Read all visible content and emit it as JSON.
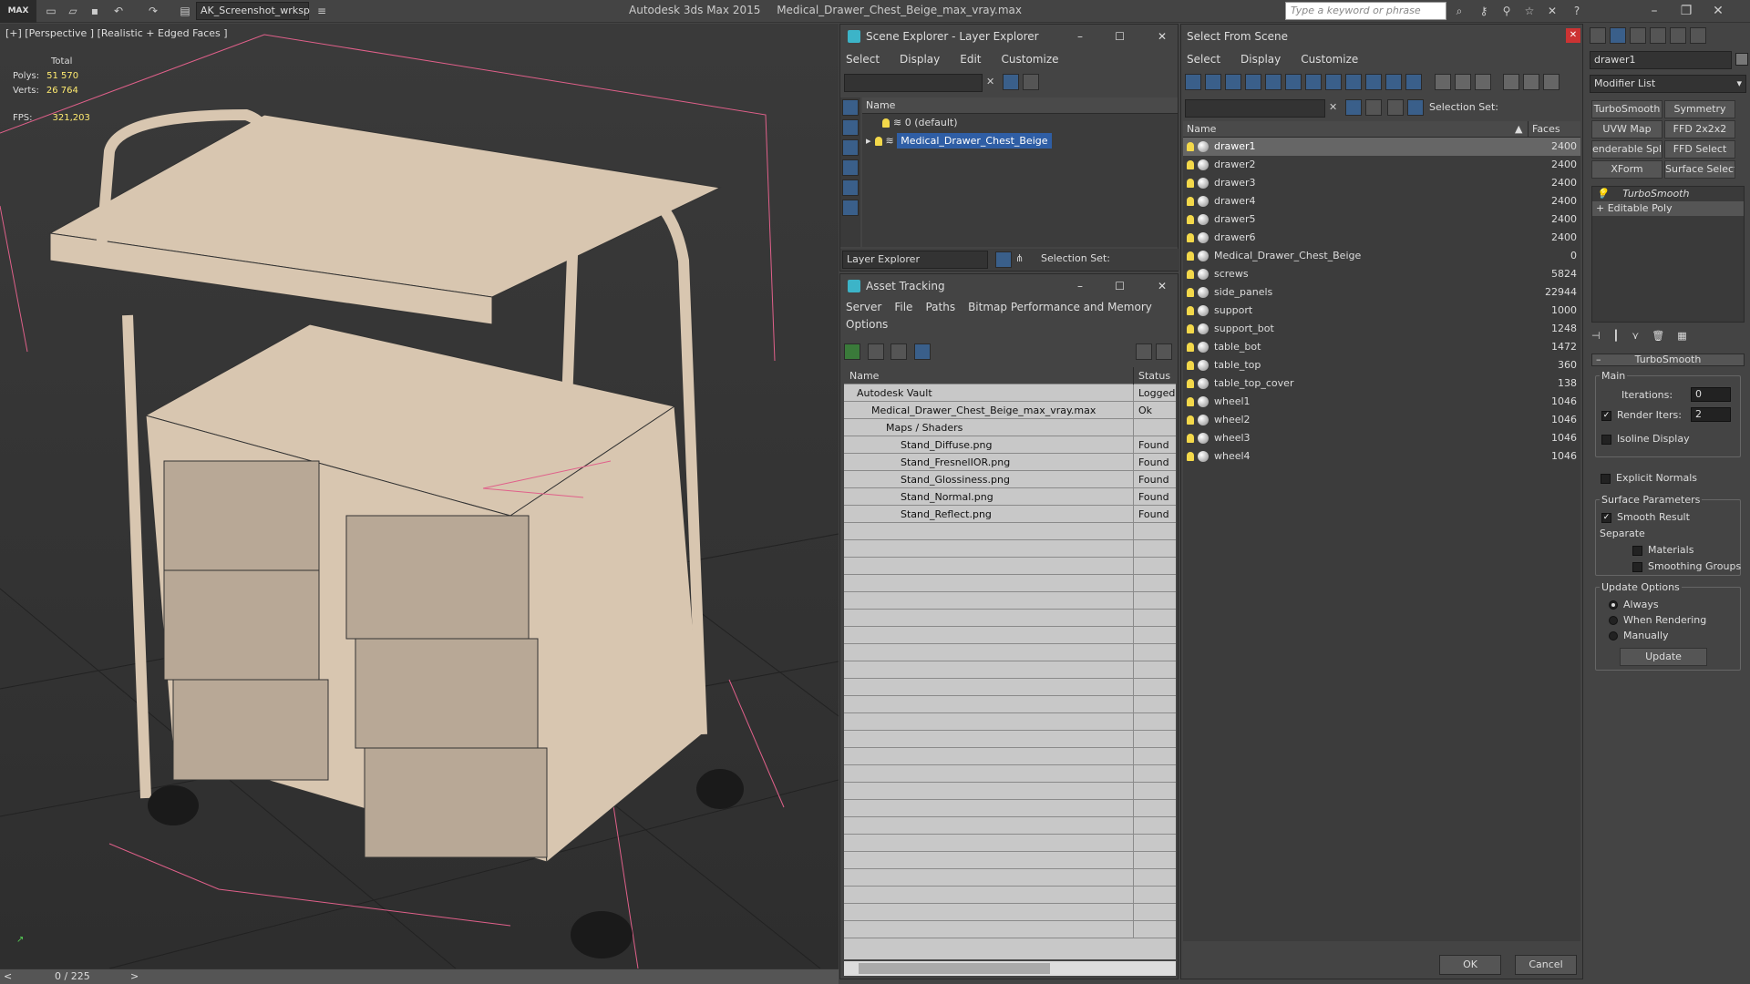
{
  "app": {
    "logo": "MAX",
    "workspace": "AK_Screenshot_wrksp",
    "title_app": "Autodesk 3ds Max  2015",
    "title_file": "Medical_Drawer_Chest_Beige_max_vray.max",
    "search_placeholder": "Type a keyword or phrase"
  },
  "viewport": {
    "label": "[+] [Perspective ] [Realistic + Edged Faces ]",
    "stats_total": "Total",
    "polys_label": "Polys:",
    "polys_value": "51 570",
    "verts_label": "Verts:",
    "verts_value": "26 764",
    "fps_label": "FPS:",
    "fps_value": "321,203",
    "frame": "0 / 225"
  },
  "scene_explorer": {
    "title": "Scene Explorer - Layer Explorer",
    "menu": [
      "Select",
      "Display",
      "Edit",
      "Customize"
    ],
    "column": "Name",
    "layers": [
      {
        "name": "0 (default)",
        "selected": false
      },
      {
        "name": "Medical_Drawer_Chest_Beige",
        "selected": true
      }
    ],
    "footer_mode": "Layer Explorer",
    "footer_selset": "Selection Set:"
  },
  "asset_tracking": {
    "title": "Asset Tracking",
    "menu": [
      "Server",
      "File",
      "Paths",
      "Bitmap Performance and Memory"
    ],
    "menu2": "Options",
    "col_name": "Name",
    "col_status": "Status",
    "rows": [
      {
        "name": "Autodesk Vault",
        "status": "Logged",
        "indent": 0
      },
      {
        "name": "Medical_Drawer_Chest_Beige_max_vray.max",
        "status": "Ok",
        "indent": 1
      },
      {
        "name": "Maps / Shaders",
        "status": "",
        "indent": 2
      },
      {
        "name": "Stand_Diffuse.png",
        "status": "Found",
        "indent": 3
      },
      {
        "name": "Stand_FresnelIOR.png",
        "status": "Found",
        "indent": 3
      },
      {
        "name": "Stand_Glossiness.png",
        "status": "Found",
        "indent": 3
      },
      {
        "name": "Stand_Normal.png",
        "status": "Found",
        "indent": 3
      },
      {
        "name": "Stand_Reflect.png",
        "status": "Found",
        "indent": 3
      }
    ]
  },
  "select_from_scene": {
    "title": "Select From Scene",
    "menu": [
      "Select",
      "Display",
      "Customize"
    ],
    "selset": "Selection Set:",
    "col_name": "Name",
    "col_faces": "Faces",
    "objects": [
      {
        "name": "drawer1",
        "faces": "2400",
        "selected": true
      },
      {
        "name": "drawer2",
        "faces": "2400"
      },
      {
        "name": "drawer3",
        "faces": "2400"
      },
      {
        "name": "drawer4",
        "faces": "2400"
      },
      {
        "name": "drawer5",
        "faces": "2400"
      },
      {
        "name": "drawer6",
        "faces": "2400"
      },
      {
        "name": "Medical_Drawer_Chest_Beige",
        "faces": "0"
      },
      {
        "name": "screws",
        "faces": "5824"
      },
      {
        "name": "side_panels",
        "faces": "22944"
      },
      {
        "name": "support",
        "faces": "1000"
      },
      {
        "name": "support_bot",
        "faces": "1248"
      },
      {
        "name": "table_bot",
        "faces": "1472"
      },
      {
        "name": "table_top",
        "faces": "360"
      },
      {
        "name": "table_top_cover",
        "faces": "138"
      },
      {
        "name": "wheel1",
        "faces": "1046"
      },
      {
        "name": "wheel2",
        "faces": "1046"
      },
      {
        "name": "wheel3",
        "faces": "1046"
      },
      {
        "name": "wheel4",
        "faces": "1046"
      }
    ],
    "ok": "OK",
    "cancel": "Cancel"
  },
  "command_panel": {
    "object_name": "drawer1",
    "modifier_list": "Modifier List",
    "mod_buttons": [
      "TurboSmooth",
      "Symmetry",
      "UVW Map",
      "FFD 2x2x2",
      "enderable Splir",
      "FFD Select",
      "XForm",
      "Surface Select"
    ],
    "stack": [
      "TurboSmooth",
      "Editable Poly"
    ],
    "rollout_title": "TurboSmooth",
    "main": "Main",
    "iterations_label": "Iterations:",
    "iterations_value": "0",
    "render_iters_label": "Render Iters:",
    "render_iters_value": "2",
    "isoline": "Isoline Display",
    "explicit": "Explicit Normals",
    "surface_params": "Surface Parameters",
    "smooth_result": "Smooth Result",
    "separate": "Separate",
    "materials": "Materials",
    "smoothing_groups": "Smoothing Groups",
    "update_options": "Update Options",
    "always": "Always",
    "when_rendering": "When Rendering",
    "manually": "Manually",
    "update_btn": "Update"
  }
}
